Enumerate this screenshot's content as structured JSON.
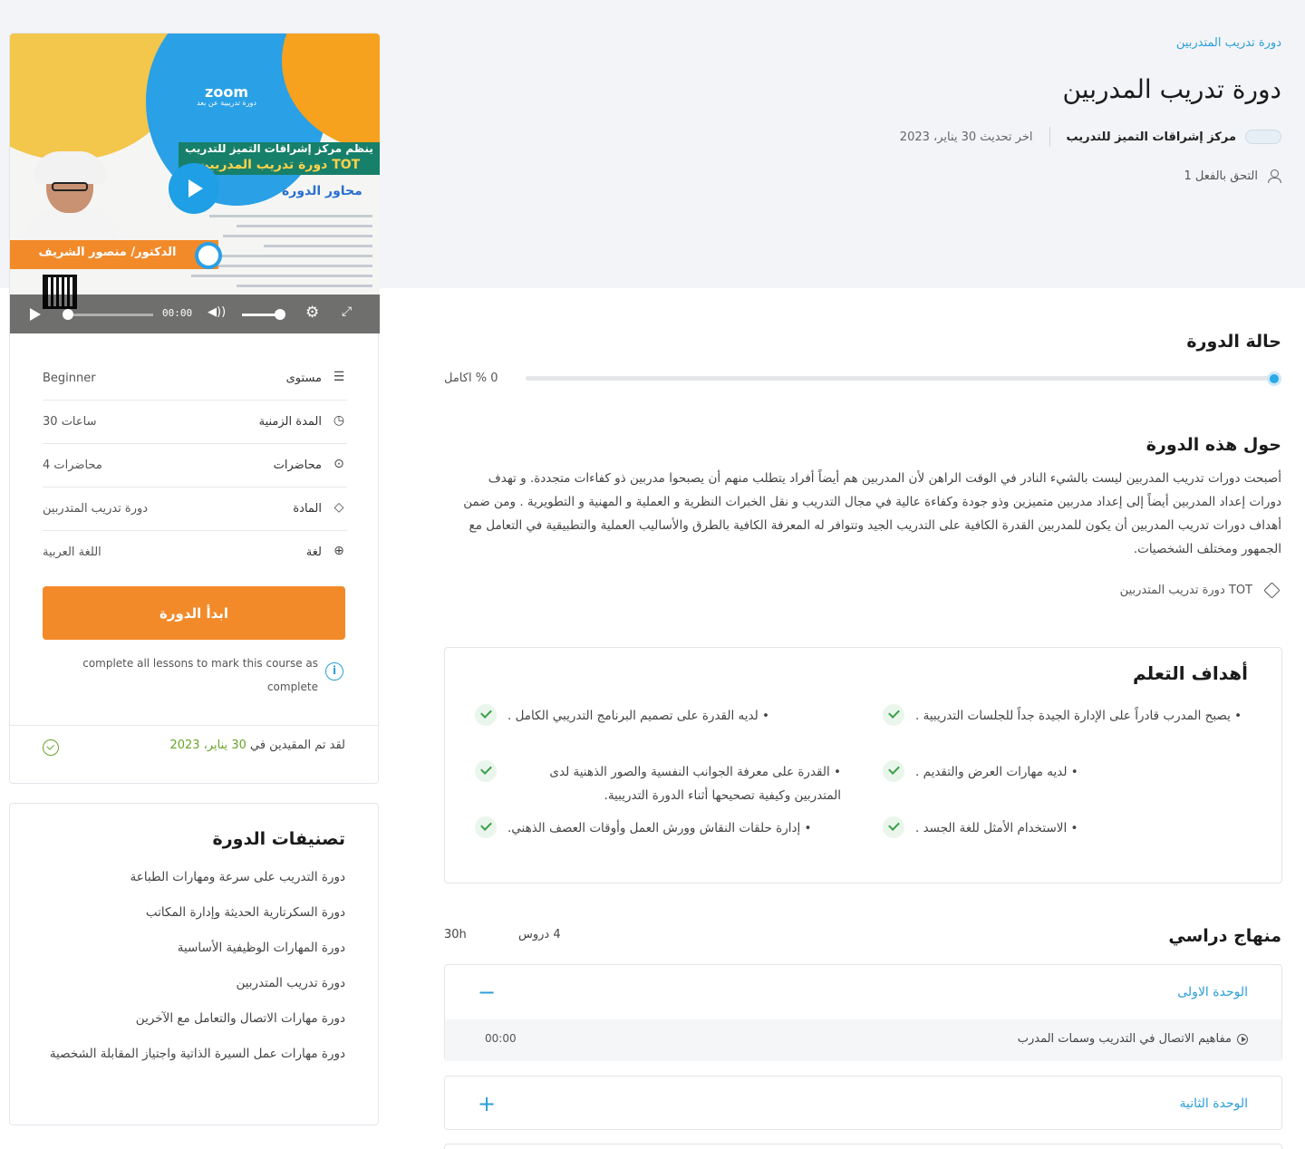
{
  "breadcrumb": "دورة تدريب المتدربين",
  "page_title": "دورة تدريب المدربين",
  "meta": {
    "org_name": "مركز إشراقات التميز للتدريب",
    "updated": "اخر تحديث 30 يناير، 2023",
    "enrolled": "1 التحق بالفعل"
  },
  "status": {
    "title": "حالة الدورة",
    "progress_percent": 0,
    "label": "0 % اكامل"
  },
  "about": {
    "title": "حول هذه الدورة",
    "text": "أصبحت دورات تدريب المدربين ليست بالشيء النادر في الوقت الراهن لأن المدربين هم أيضاً أفراد يتطلب منهم أن يصبحوا مدربين ذو كفاءات متجددة. و تهدف دورات إعداد المدربين أيضاً إلى إعداد مدربين متميزين وذو جودة وكفاءة عالية في مجال التدريب و نقل الخبرات النظرية و العملية و المهنية و التطويرية . ومن ضمن أهداف دورات تدريب المدربين أن يكون للمدربين القدرة الكافية على التدريب الجيد وتتوافر له المعرفة الكافية بالطرق والأساليب العملية والتطبيقية في التعامل مع الجمهور ومختلف الشخصيات.",
    "tag": "دورة تدريب المتدربين TOT"
  },
  "goals": {
    "title": "أهداف التعلم",
    "items": [
      "• يصبح المدرب قادراً على الإدارة الجيدة جداً للجلسات التدريبية .",
      "• لديه القدرة على تصميم البرنامج التدريبي الكامل .",
      "• لديه مهارات العرض والتقديم .",
      "• القدرة على معرفة الجوانب النفسية والصور الذهنية لدى المتدربين وكيفية تصحيحها أثناء الدورة التدريبية.",
      "• الاستخدام الأمثل للغة الجسد .",
      "• إدارة حلقات النقاش وورش العمل وأوقات العصف الذهني."
    ]
  },
  "curriculum": {
    "title": "منهاج دراسي",
    "lessons_count": "4 دروس",
    "hours": "30h",
    "units": [
      {
        "title": "الوحدة الاولى",
        "toggle": "−",
        "lessons": [
          {
            "title": "مفاهيم الاتصال في التدريب وسمات المدرب",
            "time": "00:00"
          }
        ]
      },
      {
        "title": "الوحدة الثانية",
        "toggle": "+"
      }
    ]
  },
  "video": {
    "zoom_label": "zoom",
    "zoom_sub": "دورة تدريبية عن بعد",
    "banner_top": "ينظم مركز إشراقات التميز للتدريب",
    "banner_course": "دورة تدريب المدربين TOT",
    "axes_title": "محاور الدورة",
    "instructor": "الدكتور/ منصور الشريف",
    "time": "00:00"
  },
  "sidebar": {
    "info": [
      {
        "icon": "sliders-icon",
        "glyph": "☰",
        "label": "مستوى",
        "value": "Beginner"
      },
      {
        "icon": "clock-icon",
        "glyph": "◷",
        "label": "المدة الزمنية",
        "value": "30 ساعات"
      },
      {
        "icon": "play-circle-icon",
        "glyph": "⊙",
        "label": "محاضرات",
        "value": "4 محاضرات"
      },
      {
        "icon": "tag-icon",
        "glyph": "◇",
        "label": "المادة",
        "value": "دورة تدريب المتدربين"
      },
      {
        "icon": "globe-icon",
        "glyph": "⊕",
        "label": "لغة",
        "value": "اللغة العربية"
      }
    ],
    "start_button": "ابدأ الدورة",
    "complete_note": "complete all lessons to mark this course as complete",
    "updated_prefix": "لقد تم المقيدين في ",
    "updated_date": "30 يناير، 2023"
  },
  "categories": {
    "title": "تصنيفات الدورة",
    "items": [
      "دورة التدريب على سرعة ومهارات الطباعة",
      "دورة السكرتارية الحديثة وإدارة المكاتب",
      "دورة المهارات الوظيفية الأساسية",
      "دورة تدريب المتدربين",
      "دورة مهارات الاتصال والتعامل مع الآخرين",
      "دورة مهارات عمل السيرة الذاتية واجتياز المقابلة الشخصية"
    ]
  },
  "colors": {
    "accent": "#2a9fd8",
    "button": "#f28a2a",
    "success": "#6aa329"
  }
}
